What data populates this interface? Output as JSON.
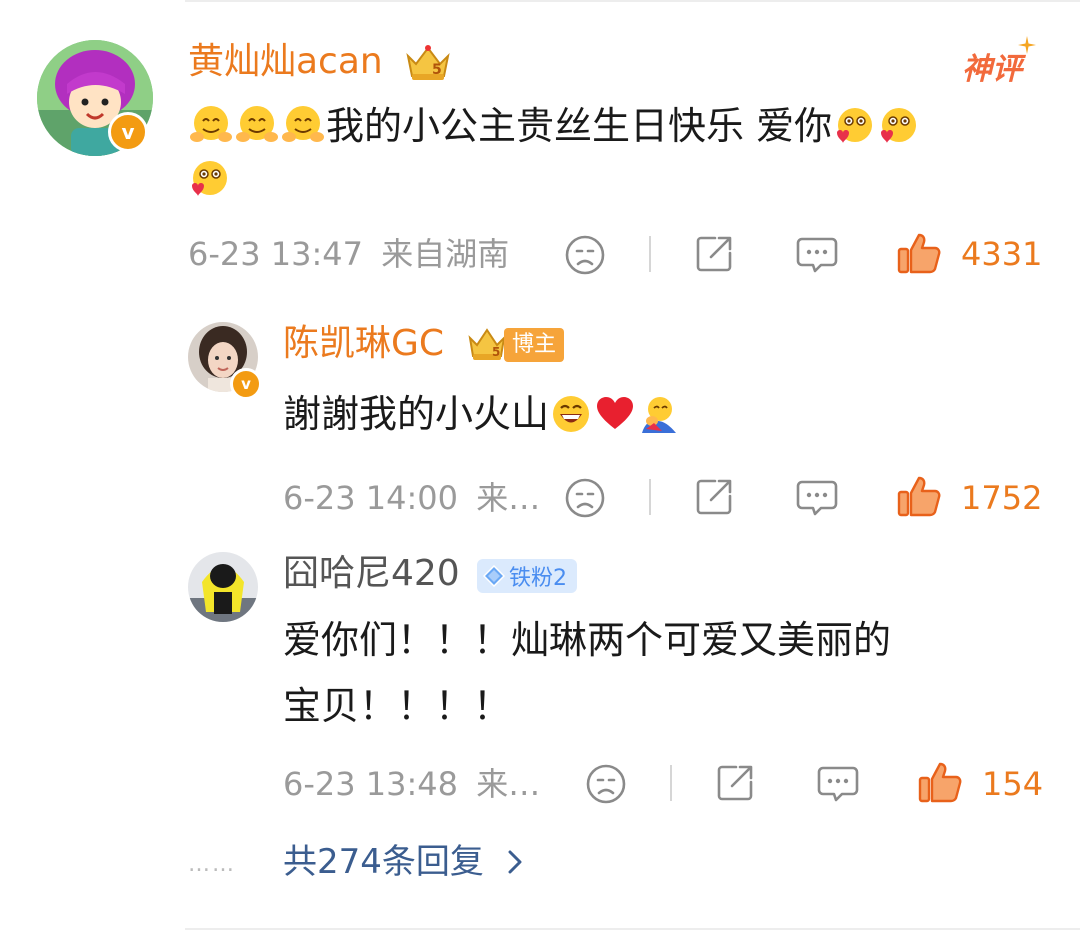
{
  "comments": [
    {
      "name": "黄灿灿acan",
      "crown_level": "5",
      "god_tag": "神评",
      "text": "我的小公主贵丝生日快乐 爱你",
      "time": "6-23 13:47",
      "location": "来自湖南",
      "likes": "4331"
    },
    {
      "name": "陈凯琳GC",
      "crown_level": "5",
      "badge": "博主",
      "text": "謝謝我的小火山",
      "time": "6-23 14:00",
      "location": "来…",
      "likes": "1752"
    },
    {
      "name": "囧哈尼420",
      "badge": "铁粉2",
      "text_line1": "爱你们！！！灿琳两个可爱又美丽的",
      "text_line2": "宝贝！！！！",
      "time": "6-23 13:48",
      "location": "来…",
      "likes": "154"
    }
  ],
  "more_replies": {
    "dots": "……",
    "label": "共274条回复"
  },
  "icons": [
    "sad-face-icon",
    "repost-icon",
    "comment-icon",
    "thumbs-up-icon",
    "chevron-right-icon",
    "crown-icon",
    "diamond-icon",
    "verified-icon"
  ],
  "colors": {
    "accent": "#eb7a1e",
    "meta_grey": "#9a9a9a",
    "link_blue": "#3b5d8f",
    "fan_badge_bg": "#dbeafd"
  }
}
